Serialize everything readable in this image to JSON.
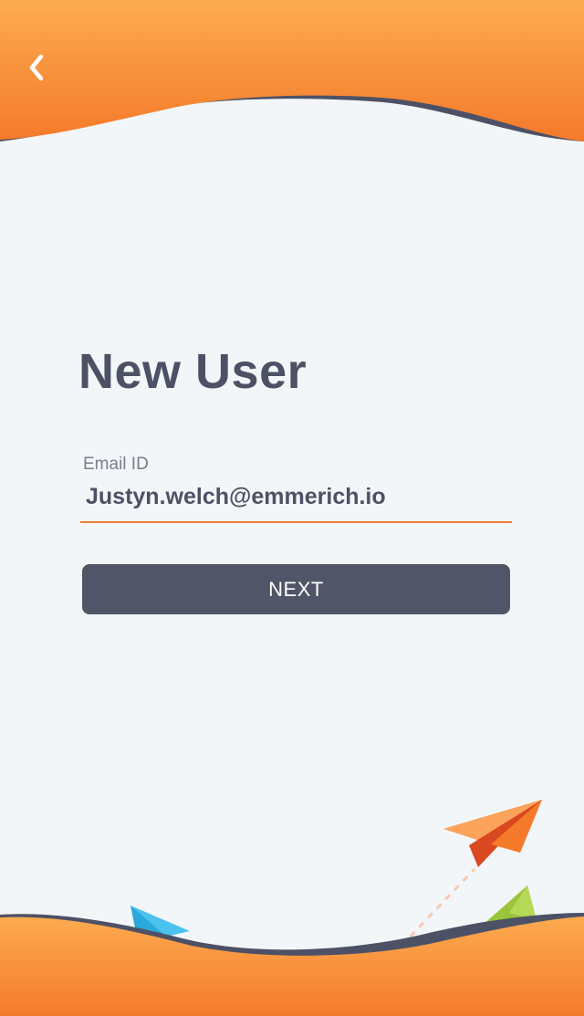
{
  "header": {
    "back_icon": "chevron-left-icon",
    "colors": {
      "gradient_top": "#fdab4f",
      "gradient_bottom": "#f47a2a",
      "wave_shadow": "#4d5165"
    }
  },
  "main": {
    "title": "New User",
    "email_field": {
      "label": "Email ID",
      "value": "Justyn.welch@emmerich.io",
      "underline_color": "#ee7d35"
    },
    "next_button": {
      "label": "NEXT",
      "color": "#515568"
    }
  },
  "decorations": {
    "icons": [
      "paper-plane-orange-icon",
      "paper-plane-blue-icon",
      "paper-plane-green-icon"
    ]
  },
  "colors": {
    "background": "#f3f6f8",
    "title_text": "#4d5165",
    "label_text": "#7a7d8c"
  }
}
